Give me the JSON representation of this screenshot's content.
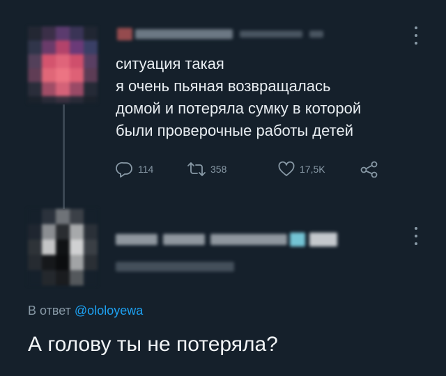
{
  "theme": {
    "background": "#15202b",
    "text": "#e6ecf0",
    "muted": "#8899a6",
    "accent": "#1da1f2"
  },
  "tweet_original": {
    "author_name_obscured": true,
    "text_lines": [
      "ситуация такая",
      "я очень пьяная возвращалась",
      "домой и потеряла сумку в которой",
      "были проверочные работы детей"
    ],
    "actions": {
      "replies": "114",
      "retweets": "358",
      "likes": "17,5K"
    },
    "icons": [
      "reply-icon",
      "retweet-icon",
      "like-icon",
      "share-icon",
      "more-icon"
    ]
  },
  "tweet_reply": {
    "author_name_obscured": true,
    "reply_to_prefix": "В ответ",
    "reply_to_handle": "@ololoyewa",
    "text": "А голову ты не потеряла?"
  }
}
